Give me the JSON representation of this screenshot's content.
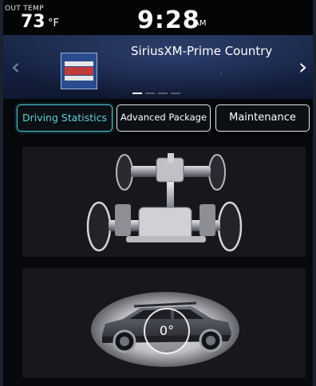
{
  "status": {
    "out_temp_label": "OUT TEMP",
    "temperature": "73",
    "temp_unit": "°F",
    "time": "9:28",
    "ampm": "AM"
  },
  "audio": {
    "station": "SiriusXM-Prime Country",
    "logo_name": "prime-country-logo",
    "page_count": 4,
    "active_page": 1
  },
  "tabs": [
    {
      "label": "Driving Statistics",
      "active": true
    },
    {
      "label": "Advanced Package",
      "active": false
    },
    {
      "label": "Maintenance",
      "active": false
    }
  ],
  "vehicle": {
    "pitch_angle": "0°"
  },
  "colors": {
    "accent": "#4fc3d0",
    "background": "#07090d"
  }
}
